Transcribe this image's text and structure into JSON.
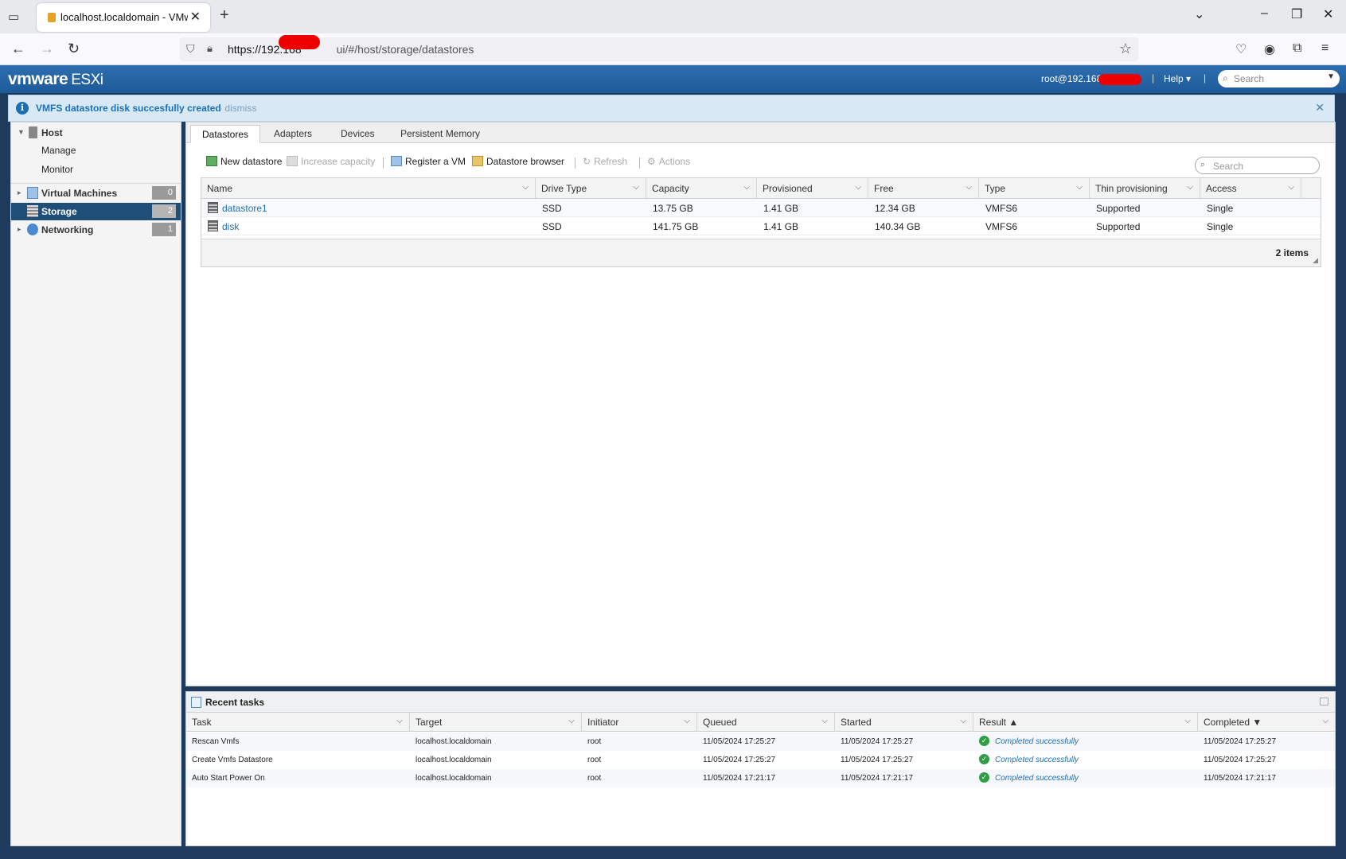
{
  "browser": {
    "tab_title": "localhost.localdomain - VMware",
    "url_host": "https://192.168",
    "url_path": "ui/#/host/storage/datastores"
  },
  "header": {
    "logo_brand": "vmware",
    "logo_product": "ESXi",
    "user": "root@192.168",
    "help": "Help",
    "search_placeholder": "Search"
  },
  "notification": {
    "message": "VMFS datastore disk succesfully created",
    "dismiss": "- dismiss"
  },
  "sidebar": {
    "host": "Host",
    "manage": "Manage",
    "monitor": "Monitor",
    "items": [
      {
        "label": "Virtual Machines",
        "count": "0"
      },
      {
        "label": "Storage",
        "count": "2"
      },
      {
        "label": "Networking",
        "count": "1"
      }
    ]
  },
  "content_tabs": [
    "Datastores",
    "Adapters",
    "Devices",
    "Persistent Memory"
  ],
  "toolbar": {
    "new_datastore": "New datastore",
    "increase_capacity": "Increase capacity",
    "register_vm": "Register a VM",
    "datastore_browser": "Datastore browser",
    "refresh": "Refresh",
    "actions": "Actions",
    "search_placeholder": "Search"
  },
  "datastores": {
    "columns": [
      "Name",
      "Drive Type",
      "Capacity",
      "Provisioned",
      "Free",
      "Type",
      "Thin provisioning",
      "Access"
    ],
    "rows": [
      [
        "datastore1",
        "SSD",
        "13.75 GB",
        "1.41 GB",
        "12.34 GB",
        "VMFS6",
        "Supported",
        "Single"
      ],
      [
        "disk",
        "SSD",
        "141.75 GB",
        "1.41 GB",
        "140.34 GB",
        "VMFS6",
        "Supported",
        "Single"
      ]
    ],
    "count": "2 items"
  },
  "recent_tasks": {
    "title": "Recent tasks",
    "columns": [
      "Task",
      "Target",
      "Initiator",
      "Queued",
      "Started",
      "Result ▲",
      "Completed ▼"
    ],
    "rows": [
      [
        "Rescan Vmfs",
        "localhost.localdomain",
        "root",
        "11/05/2024 17:25:27",
        "11/05/2024 17:25:27",
        "Completed successfully",
        "11/05/2024 17:25:27"
      ],
      [
        "Create Vmfs Datastore",
        "localhost.localdomain",
        "root",
        "11/05/2024 17:25:27",
        "11/05/2024 17:25:27",
        "Completed successfully",
        "11/05/2024 17:25:27"
      ],
      [
        "Auto Start Power On",
        "localhost.localdomain",
        "root",
        "11/05/2024 17:21:17",
        "11/05/2024 17:21:17",
        "Completed successfully",
        "11/05/2024 17:21:17"
      ]
    ]
  },
  "colors": {
    "header_blue": "#1f5a98",
    "active_nav": "#1f4e79",
    "link": "#1a6fb8",
    "success": "#2f9e44"
  }
}
